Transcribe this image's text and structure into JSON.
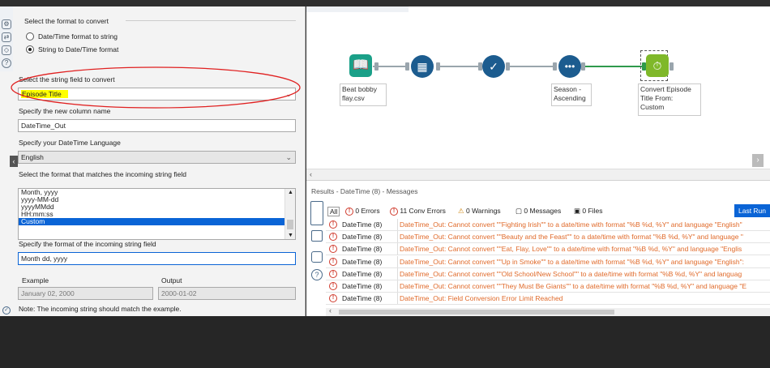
{
  "config": {
    "format_section_title": "Select the format to convert",
    "radio_options": [
      "Date/Time format to string",
      "String to Date/Time format"
    ],
    "selected_radio": 1,
    "string_field_label": "Select the string field to convert",
    "string_field_value": "Episode Title",
    "new_column_label": "Specify the new column name",
    "new_column_value": "DateTime_Out",
    "language_label": "Specify your DateTime Language",
    "language_value": "English",
    "incoming_format_label": "Select the format that matches the incoming string field",
    "format_options": [
      "Month, yyyy",
      "yyyy-MM-dd",
      "yyyyMMdd",
      "HH:mm:ss",
      "Custom"
    ],
    "selected_format": "Custom",
    "custom_format_label": "Specify the format of the incoming string field",
    "custom_format_value": "Month dd, yyyy",
    "example_label": "Example",
    "output_label": "Output",
    "example_value": "January 02, 2000",
    "output_value": "2000-01-02",
    "note": "Note: The incoming string should match the example."
  },
  "workflow": {
    "nodes": [
      {
        "name": "input-data-node",
        "label": "Beat bobby\nflay.csv",
        "color": "#1aa088"
      },
      {
        "name": "select-node",
        "label": "",
        "color": "#1c5c8f"
      },
      {
        "name": "filter-node",
        "label": "",
        "color": "#1c5c8f"
      },
      {
        "name": "sort-node",
        "label": "Season -\nAscending",
        "color": "#1c5c8f"
      },
      {
        "name": "datetime-node",
        "label": "Convert Episode\nTitle From:\nCustom",
        "color": "#7fb82a"
      }
    ]
  },
  "results": {
    "title": "Results - DateTime (8) - Messages",
    "tab_all": "All",
    "errors": "0 Errors",
    "conv_errors": "11 Conv Errors",
    "warnings": "0 Warnings",
    "messages": "0 Messages",
    "files": "0 Files",
    "last_run": "Last Run",
    "rows": [
      {
        "src": "DateTime (8)",
        "msg": "DateTime_Out: Cannot convert \"\"Fighting Irish\"\" to a date/time with format \"%B %d, %Y\" and language \"English\""
      },
      {
        "src": "DateTime (8)",
        "msg": "DateTime_Out: Cannot convert \"\"Beauty and the Feast\"\" to a date/time with format \"%B %d, %Y\" and language \""
      },
      {
        "src": "DateTime (8)",
        "msg": "DateTime_Out: Cannot convert \"\"Eat, Flay, Love\"\" to a date/time with format \"%B %d, %Y\" and language \"Englis"
      },
      {
        "src": "DateTime (8)",
        "msg": "DateTime_Out: Cannot convert \"\"Up in Smoke\"\" to a date/time with format \"%B %d, %Y\" and language \"English\":"
      },
      {
        "src": "DateTime (8)",
        "msg": "DateTime_Out: Cannot convert \"\"Old School/New School\"\" to a date/time with format \"%B %d, %Y\" and languag"
      },
      {
        "src": "DateTime (8)",
        "msg": "DateTime_Out: Cannot convert \"\"They Must Be Giants\"\" to a date/time with format \"%B %d, %Y\" and language \"E"
      },
      {
        "src": "DateTime (8)",
        "msg": "DateTime_Out: Field Conversion Error Limit Reached"
      }
    ]
  },
  "colors": {
    "accent": "#0a64d6",
    "error": "#d03a2c",
    "message": "#e06a2a",
    "annotation": "#e02020",
    "highlight": "#ffff00"
  }
}
